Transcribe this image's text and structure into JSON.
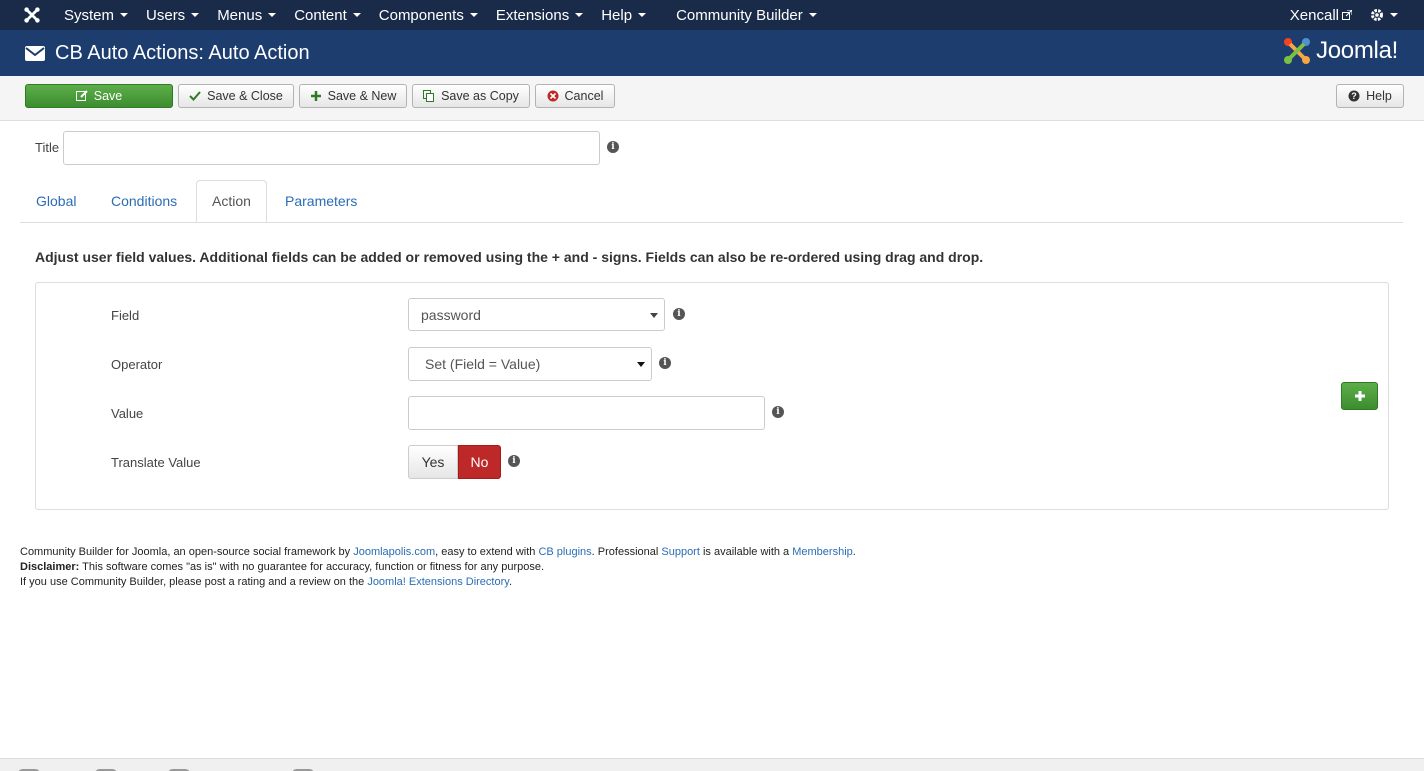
{
  "nav": {
    "menus": [
      "System",
      "Users",
      "Menus",
      "Content",
      "Components",
      "Extensions",
      "Help"
    ],
    "community_builder": "Community Builder",
    "user": "Xencall"
  },
  "header": {
    "title": "CB Auto Actions: Auto Action",
    "brand": "Joomla!"
  },
  "toolbar": {
    "save": "Save",
    "save_close": "Save & Close",
    "save_new": "Save & New",
    "save_copy": "Save as Copy",
    "cancel": "Cancel",
    "help": "Help"
  },
  "form": {
    "title_label": "Title",
    "title_value": ""
  },
  "tabs": [
    "Global",
    "Conditions",
    "Action",
    "Parameters"
  ],
  "active_tab": "Action",
  "description": "Adjust user field values. Additional fields can be added or removed using the + and - signs. Fields can also be re-ordered using drag and drop.",
  "action": {
    "field_label": "Field",
    "field_value": "password",
    "operator_label": "Operator",
    "operator_value": "Set (Field = Value)",
    "value_label": "Value",
    "value_value": "",
    "translate_label": "Translate Value",
    "yes": "Yes",
    "no": "No",
    "selected": "No"
  },
  "footer": {
    "line1_a": "Community Builder for Joomla, an open-source social framework by ",
    "joomlapolis": "Joomlapolis.com",
    "line1_b": ", easy to extend with ",
    "cb_plugins": "CB plugins",
    "line1_c": ". Professional ",
    "support": "Support",
    "line1_d": " is available with a ",
    "membership": "Membership",
    "line1_e": ".",
    "disclaimer_label": "Disclaimer:",
    "disclaimer_text": " This software comes \"as is\" with no guarantee for accuracy, function or fitness for any purpose.",
    "line3_a": "If you use Community Builder, please post a rating and a review on the ",
    "jed": "Joomla! Extensions Directory",
    "line3_b": "."
  },
  "colors": {
    "topnav": "#1a2b4a",
    "header": "#1c3d6e",
    "save_green": "#46a546",
    "no_red": "#bd2828",
    "link": "#2a6db5"
  }
}
